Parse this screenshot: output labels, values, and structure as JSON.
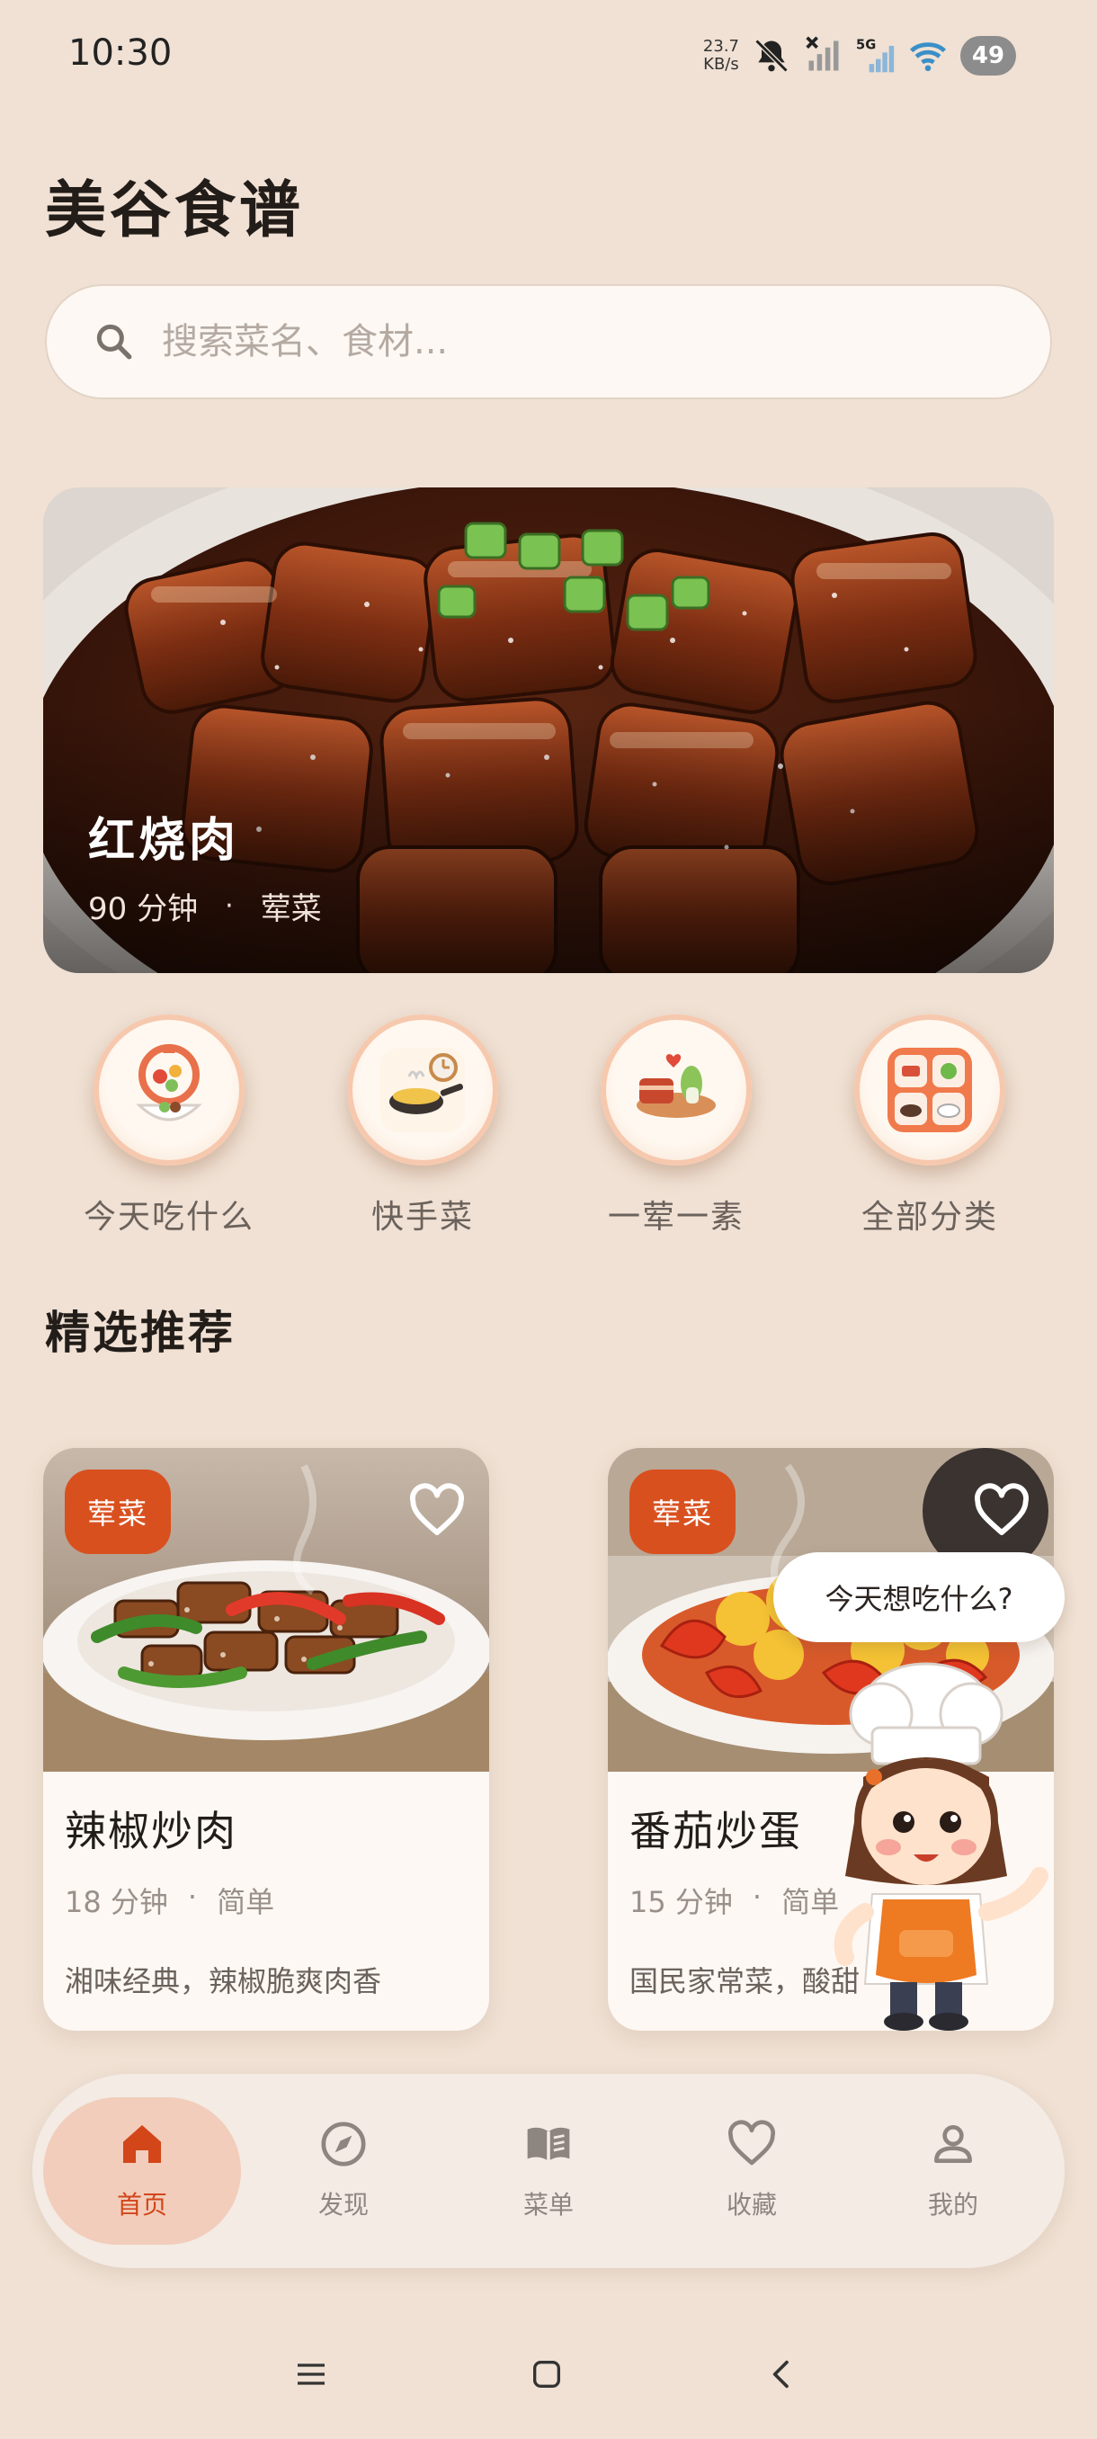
{
  "status_bar": {
    "time": "10:30",
    "net_speed_value": "23.7",
    "net_speed_unit": "KB/s",
    "network_type": "5G",
    "battery": "49",
    "icons": [
      "bell-off-icon",
      "signal-off-icon",
      "signal-5g-icon",
      "wifi-icon",
      "battery-icon"
    ]
  },
  "app": {
    "title": "美谷食谱"
  },
  "search": {
    "placeholder": "搜索菜名、食材..."
  },
  "hero": {
    "title": "红烧肉",
    "time": "90 分钟",
    "separator": "·",
    "category": "荤菜"
  },
  "categories": [
    {
      "label": "今天吃什么",
      "icon": "random-dish-icon"
    },
    {
      "label": "快手菜",
      "icon": "quick-cook-icon"
    },
    {
      "label": "一荤一素",
      "icon": "meat-veg-icon"
    },
    {
      "label": "全部分类",
      "icon": "all-categories-icon"
    }
  ],
  "featured": {
    "title": "精选推荐",
    "cards": [
      {
        "tag": "荤菜",
        "title": "辣椒炒肉",
        "time": "18 分钟",
        "separator": "·",
        "difficulty": "简单",
        "desc": "湘味经典，辣椒脆爽肉香"
      },
      {
        "tag": "荤菜",
        "title": "番茄炒蛋",
        "time": "15 分钟",
        "separator": "·",
        "difficulty": "简单",
        "desc": "国民家常菜，酸甜"
      }
    ]
  },
  "mascot": {
    "bubble": "今天想吃什么?"
  },
  "bottom_nav": [
    {
      "label": "首页",
      "icon": "home-icon",
      "active": true
    },
    {
      "label": "发现",
      "icon": "compass-icon",
      "active": false
    },
    {
      "label": "菜单",
      "icon": "book-icon",
      "active": false
    },
    {
      "label": "收藏",
      "icon": "heart-icon",
      "active": false
    },
    {
      "label": "我的",
      "icon": "user-icon",
      "active": false
    }
  ],
  "colors": {
    "background": "#f0e1d4",
    "accent": "#d9501f",
    "active_nav": "#f2cdbb"
  }
}
